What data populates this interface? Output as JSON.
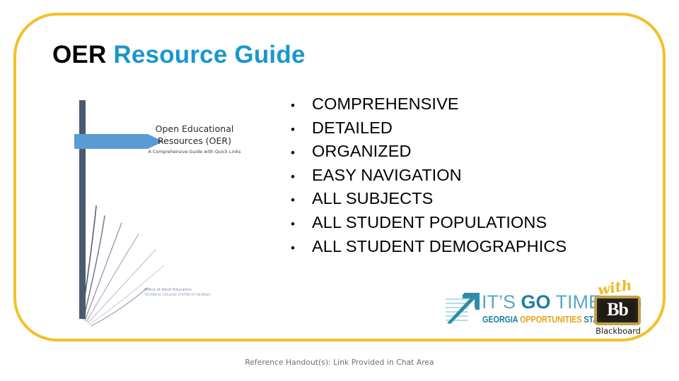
{
  "slide": {
    "title_primary": "OER",
    "title_secondary": "Resource Guide",
    "accent_blue": "#1B96CE",
    "frame_color": "#F2C028",
    "background": "#ffffff"
  },
  "bullets": {
    "marker": "•",
    "items": [
      "COMPREHENSIVE",
      "DETAILED",
      "ORGANIZED",
      "EASY NAVIGATION",
      "ALL SUBJECTS",
      "ALL STUDENT POPULATIONS",
      "ALL STUDENT DEMOGRAPHICS"
    ]
  },
  "thumbnail": {
    "heading": "Open Educational Resources (OER)",
    "subheading": "A Comprehensive Guide with Quick Links",
    "footer_line1": "Office of Adult Education",
    "footer_line2": "TECHNICAL COLLEGE SYSTEM OF GEORGIA",
    "post_color": "#4A5A70",
    "arrow_color": "#5B9BD5"
  },
  "logo": {
    "word_its": "IT’S ",
    "word_go": "GO",
    "word_time": " TIME",
    "tagline_part1": "GEORGIA ",
    "tagline_part2": "OPPORTUNITIES",
    "tagline_part3": " START HERE",
    "with_text": "with",
    "blackboard_mark": "Bb",
    "blackboard_registered": "®",
    "blackboard_name": "Blackboard",
    "teal": "#1E7F9E",
    "light_teal": "#5BA7C4",
    "gold": "#E8A31A"
  },
  "footer": {
    "caption": "Reference Handout(s): Link Provided in Chat Area"
  }
}
